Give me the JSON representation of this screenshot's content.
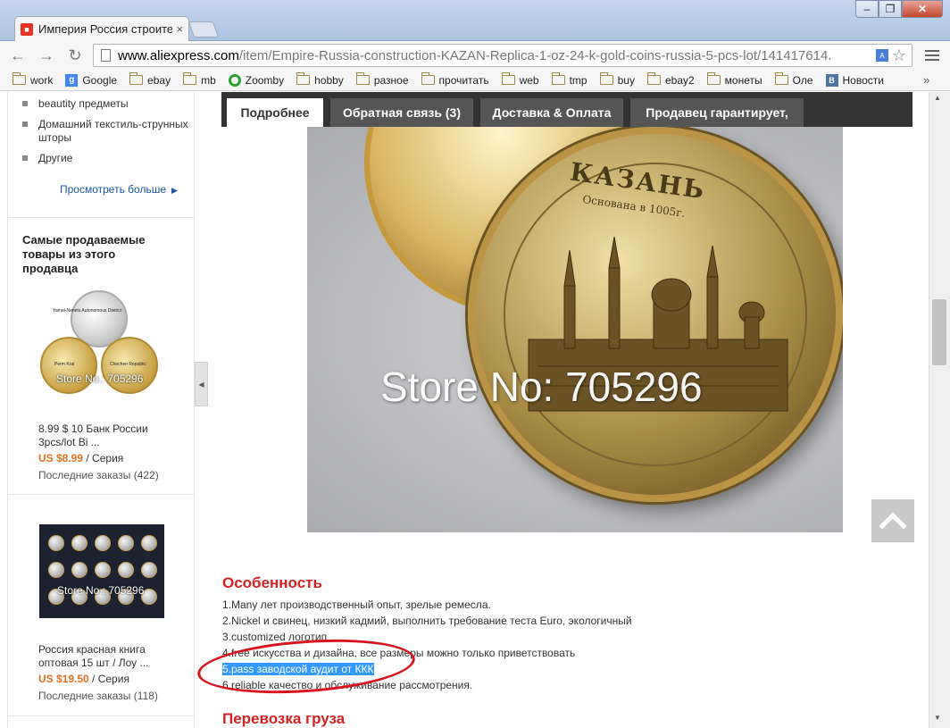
{
  "browser": {
    "tab_title": "Империя Россия строите",
    "tab_close": "×",
    "url_host": "www.aliexpress.com",
    "url_path": "/item/Empire-Russia-construction-KAZAN-Replica-1-oz-24-k-gold-coins-russia-5-pcs-lot/141417614.",
    "window_min": "–",
    "window_max": "❐",
    "window_close": "✕"
  },
  "bookmarks": [
    {
      "label": "work",
      "icon": "folder-icon"
    },
    {
      "label": "Google",
      "icon": "google-icon"
    },
    {
      "label": "ebay",
      "icon": "folder-icon"
    },
    {
      "label": "mb",
      "icon": "folder-icon"
    },
    {
      "label": "Zoomby",
      "icon": "zoomby-icon"
    },
    {
      "label": "hobby",
      "icon": "folder-icon"
    },
    {
      "label": "разное",
      "icon": "folder-icon"
    },
    {
      "label": "прочитать",
      "icon": "folder-icon"
    },
    {
      "label": "web",
      "icon": "folder-icon"
    },
    {
      "label": "tmp",
      "icon": "folder-icon"
    },
    {
      "label": "buy",
      "icon": "folder-icon"
    },
    {
      "label": "ebay2",
      "icon": "folder-icon"
    },
    {
      "label": "монеты",
      "icon": "folder-icon"
    },
    {
      "label": "Оле",
      "icon": "folder-icon"
    },
    {
      "label": "Новости",
      "icon": "vk-icon"
    }
  ],
  "bookmarks_more": "»",
  "sidebar": {
    "categories": [
      "beautity предметы",
      "Домашний текстиль-струнных шторы",
      "Другие"
    ],
    "see_more": "Просмотреть больше",
    "best_sellers_title": "Самые продаваемые товары из этого продавца",
    "products": [
      {
        "desc": "8.99 $ 10 Банк России 3pcs/lot Bi ...",
        "price": "US $8.99",
        "unit": " / Серия",
        "orders": "Последние заказы (422)",
        "watermark": "Store No.: 705296",
        "caption_1": "Yamal-Nenets Autonomous District",
        "caption_2": "Perm Krai",
        "caption_3": "Chechen Republic"
      },
      {
        "desc": "Россия красная книга оптовая 15 шт / Лоу ...",
        "price": "US $19.50",
        "unit": " / Серия",
        "orders": "Последние заказы (118)",
        "watermark": "Store No.: 705296"
      }
    ]
  },
  "detail_tabs": [
    {
      "label": "Подробнее",
      "active": true
    },
    {
      "label": "Обратная связь (3)",
      "active": false
    },
    {
      "label": "Доставка & Оплата",
      "active": false
    },
    {
      "label": "Продавец гарантирует,",
      "active": false
    }
  ],
  "product_image": {
    "coin_title": "КАЗАНЬ",
    "coin_subtitle": "Основана в 1005г.",
    "watermark": "Store No: 705296"
  },
  "features": {
    "title": "Особенность",
    "items": [
      "1.Many лет производственный опыт, зрелые ремесла.",
      "2.Nickel и свинец, низкий кадмий, выполнить требование теста Euro, экологичный",
      "3.customized логотип",
      "4.free искусства и дизайна, все размеры можно только приветствовать",
      "5.pass заводской аудит от ККК",
      "6.reliable качество и обслуживание рассмотрения."
    ],
    "highlighted_index": 4
  },
  "shipping_title": "Перевозка груза"
}
